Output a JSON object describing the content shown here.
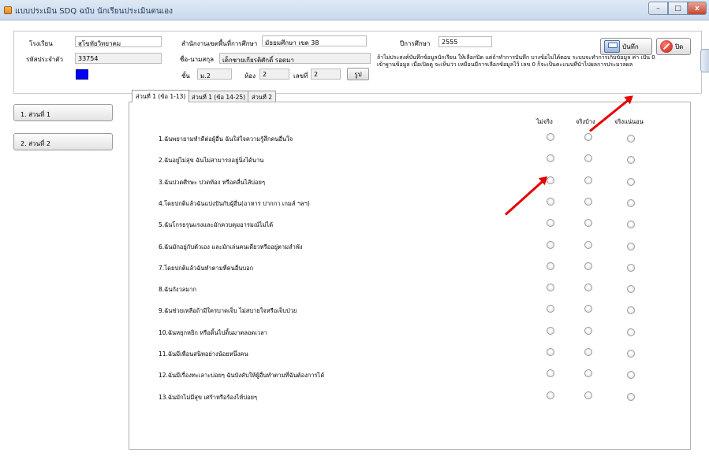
{
  "window": {
    "title": "แบบประเมิน SDQ ฉบับ นักเรียนประเมินตนเอง",
    "minimize": "–",
    "maximize": "□",
    "close": "x"
  },
  "header": {
    "school_label": "โรงเรียน",
    "school_value": "สุโขทัยวิทยาคม",
    "office_label": "สำนักงานเขตพื้นที่การศึกษา",
    "office_value": "มัธยมศึกษา เขต 38",
    "year_label": "ปีการศึกษา",
    "year_value": "2555",
    "student_id_label": "รหัสประจำตัว",
    "student_id_value": "33754",
    "name_label": "ชื่อ-นามสกุล",
    "name_value": "เด็กชายเกียรติศักดิ์ รอดมา",
    "class_label": "ชั้น",
    "class_value": "ม.2",
    "room_label": "ห้อง",
    "room_value": "2",
    "number_label": "เลขที่",
    "number_value": "2",
    "picture_button": "รูป",
    "note": "ถ้าไม่ประสงค์บันทึกข้อมูลนักเรียน ให้เลือกปิด แต่ถ้าทำการบันทึก บางข้อไม่ได้ตอบ ระบบจะทำการเก็บข้อมูล ค่า เป็น 0 เข้าฐานข้อมูล เมื่อเปิดดู จะเห็นว่า เหมือนมีการเลือกข้อมูลไว้ เลข 0 ก็จะเป็นคะแนนที่นำไปผลการประมวลผล",
    "save_button": "บันทึก",
    "close_button": "ปิด",
    "color_swatch": "#0000ff"
  },
  "sidebar": {
    "items": [
      {
        "label": "1. ส่วนที่ 1"
      },
      {
        "label": "2. ส่วนที่ 2"
      }
    ]
  },
  "tabs": [
    {
      "label": "ส่วนที่ 1 (ข้อ 1-13)",
      "active": true
    },
    {
      "label": "ส่วนที่ 1 (ข้อ 14-25)",
      "active": false
    },
    {
      "label": "ส่วนที่ 2",
      "active": false
    }
  ],
  "columns": [
    "ไม่จริง",
    "จริงบ้าง",
    "จริงแน่นอน"
  ],
  "questions": [
    "1.ฉันพยายามทำดีต่อผู้อื่น ฉันใส่ใจความรู้สึกคนอื่นใจ",
    "2.ฉันอยู่ไม่สุข ฉันไม่สามารถอยู่นิ่งได้นาน",
    "3.ฉันปวดศีรษะ ปวดท้อง หรือคลื่นไส้บ่อยๆ",
    "4.โดยปกติแล้วฉันแบ่งปันกับผู้อื่น(อาหาร ปากกา เกมส์ ฯลฯ)",
    "5.ฉันโกรธรุนแรงและมักควบคุมอารมณ์ไม่ได้",
    "6.ฉันมักอยู่กับตัวเอง และมักเล่นคนเดียวหรืออยู่ตามลำพัง",
    "7.โดยปกติแล้วฉันทำตามที่คนอื่นบอก",
    "8.ฉันกังวลมาก",
    "9.ฉันช่วยเหลือถ้ามีใครบาดเจ็บ ไม่สบายใจหรือเจ็บป่วย",
    "10.ฉันหยุกหยิก หรือดิ้นไปดิ้นมาตลอดเวลา",
    "11.ฉันมีเพื่อนสนิทอย่างน้อยหนึ่งคน",
    "12.ฉันมีเรื่องทะเลาะบ่อยๆ ฉันบังคับให้ผู้อื่นทำตามที่ฉันต้องการได้",
    "13.ฉันมักไม่มีสุข เศร้าหรือร้องไห้บ่อยๆ"
  ],
  "annotation_color": "#e60000"
}
